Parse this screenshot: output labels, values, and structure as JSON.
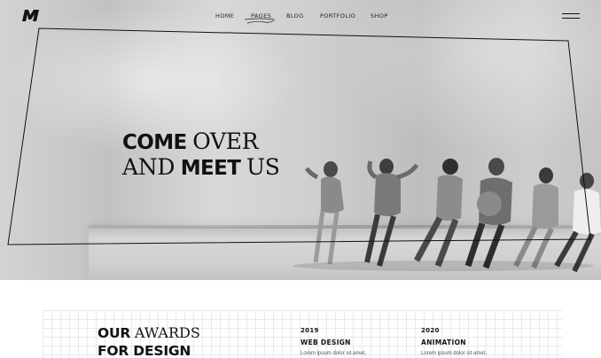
{
  "nav": {
    "items": [
      "HOME",
      "PAGES",
      "BLOG",
      "PORTFOLIO",
      "SHOP"
    ],
    "active": "PAGES"
  },
  "hero": {
    "title_line1_bold": "COME",
    "title_line1_light": "OVER",
    "title_line2_light": "AND",
    "title_line2_bold": "MEET",
    "title_line2_light_end": "US"
  },
  "awards": {
    "title_line1_bold": "OUR",
    "title_line1_light": "AWARDS",
    "title_line2_bold": "FOR DESIGN",
    "items": [
      {
        "year": "2019",
        "category": "WEB DESIGN",
        "description": "Lorem ipsum dolor sit amet,"
      },
      {
        "year": "2020",
        "category": "ANIMATION",
        "description": "Lorem ipsum dolor sit amet,"
      }
    ]
  },
  "colors": {
    "text": "#111111",
    "muted": "#555555",
    "grid": "#e9e9e9"
  },
  "icons": [
    "logo-mark",
    "menu-icon"
  ]
}
